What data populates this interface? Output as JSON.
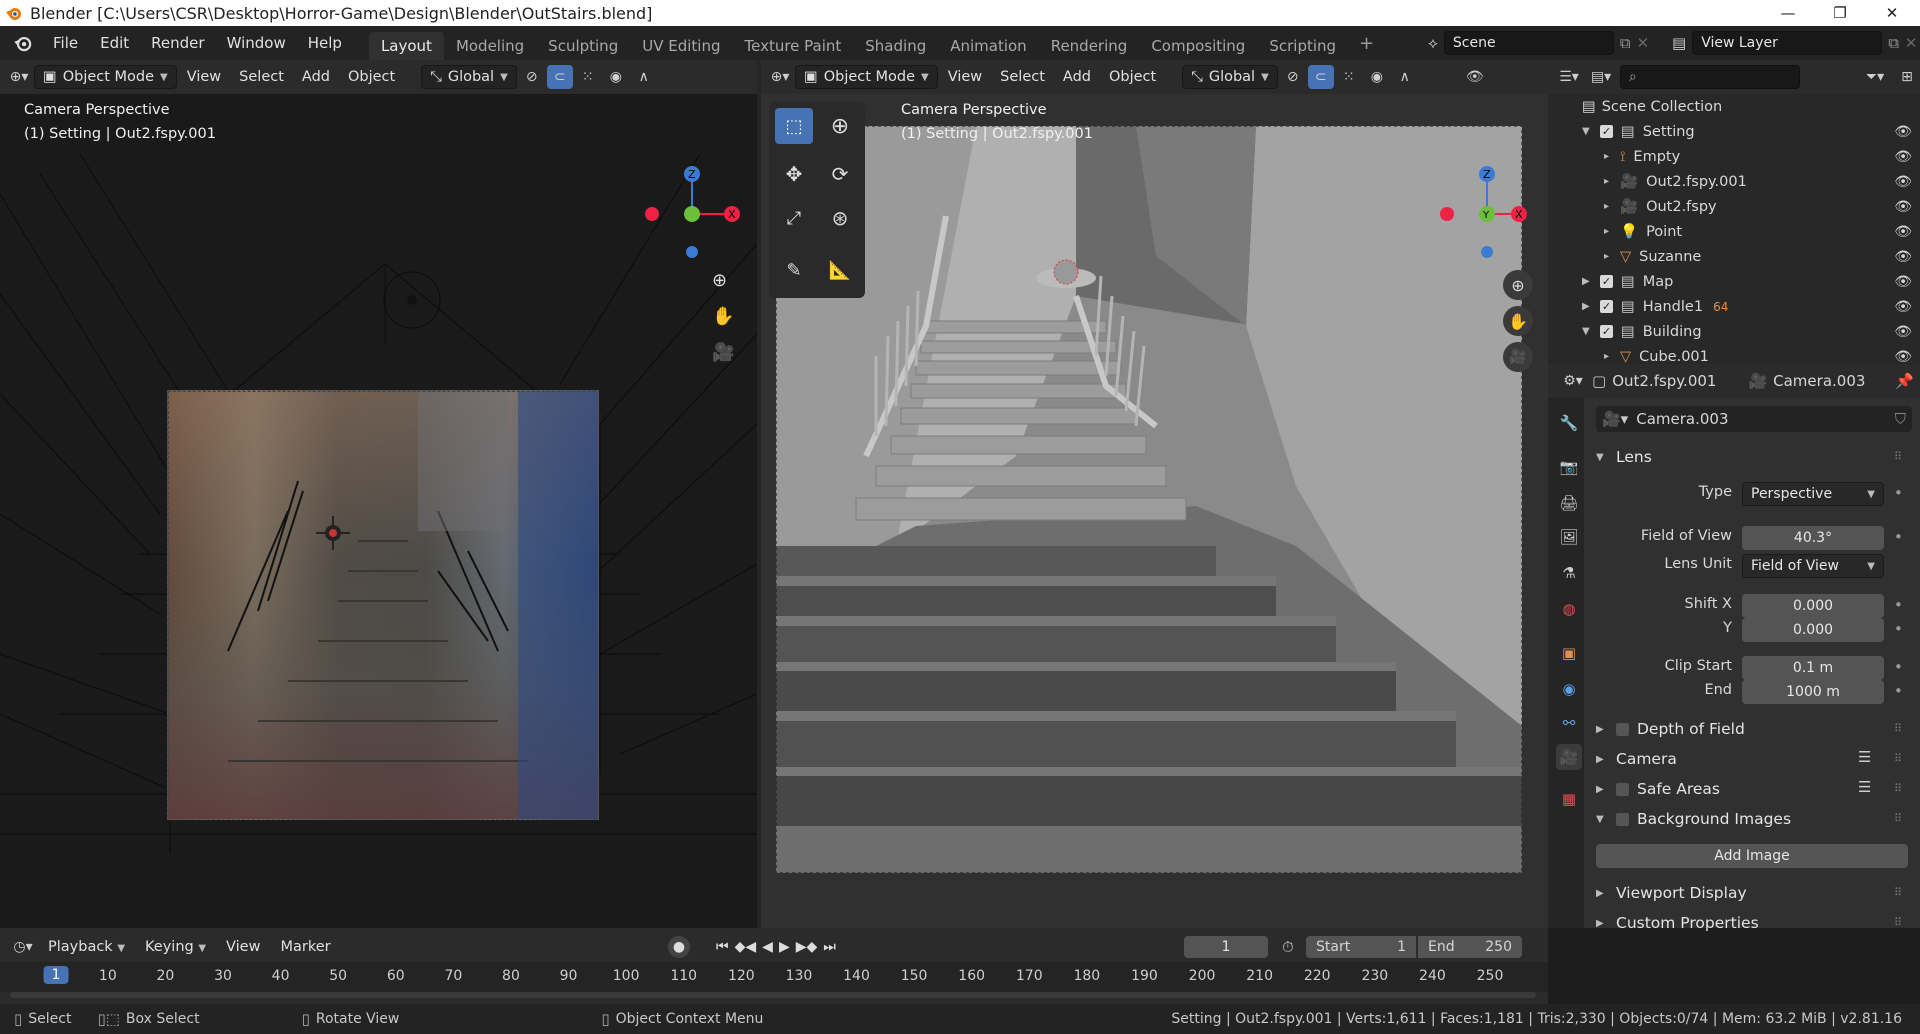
{
  "window": {
    "title": "Blender [C:\\Users\\CSR\\Desktop\\Horror-Game\\Design\\Blender\\OutStairs.blend]",
    "minimize": "—",
    "maximize": "❐",
    "close": "✕"
  },
  "menu": [
    "File",
    "Edit",
    "Render",
    "Window",
    "Help"
  ],
  "workspaces": [
    "Layout",
    "Modeling",
    "Sculpting",
    "UV Editing",
    "Texture Paint",
    "Shading",
    "Animation",
    "Rendering",
    "Compositing",
    "Scripting"
  ],
  "workspace_add": "+",
  "scene": {
    "label": "Scene",
    "view_layer": "View Layer"
  },
  "left_view": {
    "mode": "Object Mode",
    "menus": [
      "View",
      "Select",
      "Add",
      "Object"
    ],
    "orientation": "Global",
    "title": "Camera Perspective",
    "subtitle": "(1) Setting | Out2.fspy.001"
  },
  "right_view": {
    "mode": "Object Mode",
    "menus": [
      "View",
      "Select",
      "Add",
      "Object"
    ],
    "orientation": "Global",
    "title": "Camera Perspective",
    "subtitle": "(1) Setting | Out2.fspy.001"
  },
  "gizmo": {
    "z": "Z",
    "x": "X",
    "y": "Y"
  },
  "outliner": {
    "root": "Scene Collection",
    "items": [
      {
        "name": "Setting",
        "type": "collection",
        "indent": 0,
        "expanded": true
      },
      {
        "name": "Empty",
        "type": "empty",
        "indent": 1
      },
      {
        "name": "Out2.fspy.001",
        "type": "camera",
        "indent": 1
      },
      {
        "name": "Out2.fspy",
        "type": "camera",
        "indent": 1
      },
      {
        "name": "Point",
        "type": "light",
        "indent": 1
      },
      {
        "name": "Suzanne",
        "type": "mesh",
        "indent": 1
      },
      {
        "name": "Map",
        "type": "collection",
        "indent": 0,
        "expanded": false
      },
      {
        "name": "Handle1",
        "type": "collection",
        "indent": 0,
        "expanded": false,
        "badge": "64"
      },
      {
        "name": "Building",
        "type": "collection",
        "indent": 0,
        "expanded": true
      },
      {
        "name": "Cube.001",
        "type": "mesh",
        "indent": 1
      }
    ]
  },
  "properties": {
    "breadcrumb_object": "Out2.fspy.001",
    "breadcrumb_data": "Camera.003",
    "datablock": "Camera.003",
    "lens_section": "Lens",
    "type_label": "Type",
    "type_value": "Perspective",
    "fov_label": "Field of View",
    "fov_value": "40.3°",
    "lens_unit_label": "Lens Unit",
    "lens_unit_value": "Field of View",
    "shiftx_label": "Shift X",
    "shiftx_value": "0.000",
    "shifty_label": "Y",
    "shifty_value": "0.000",
    "clip_start_label": "Clip Start",
    "clip_start_value": "0.1 m",
    "clip_end_label": "End",
    "clip_end_value": "1000 m",
    "sections": [
      "Depth of Field",
      "Camera",
      "Safe Areas",
      "Background Images"
    ],
    "add_image": "Add Image",
    "sections2": [
      "Viewport Display",
      "Custom Properties"
    ]
  },
  "timeline": {
    "menus": [
      "Playback",
      "Keying",
      "View",
      "Marker"
    ],
    "current_frame": "1",
    "start_label": "Start",
    "start": "1",
    "end_label": "End",
    "end": "250",
    "ticks": [
      "1",
      "10",
      "20",
      "30",
      "40",
      "50",
      "60",
      "70",
      "80",
      "90",
      "100",
      "110",
      "120",
      "130",
      "140",
      "150",
      "160",
      "170",
      "180",
      "190",
      "200",
      "210",
      "220",
      "230",
      "240",
      "250"
    ]
  },
  "statusbar": {
    "select": "Select",
    "box_select": "Box Select",
    "rotate": "Rotate View",
    "context": "Object Context Menu",
    "info": "Setting | Out2.fspy.001 | Verts:1,611 | Faces:1,181 | Tris:2,330 | Objects:0/74 | Mem: 63.2 MiB | v2.81.16"
  },
  "colors": {
    "accent": "#4772b3",
    "bg": "#1d1d1d",
    "panel": "#303030",
    "field": "#545454"
  }
}
